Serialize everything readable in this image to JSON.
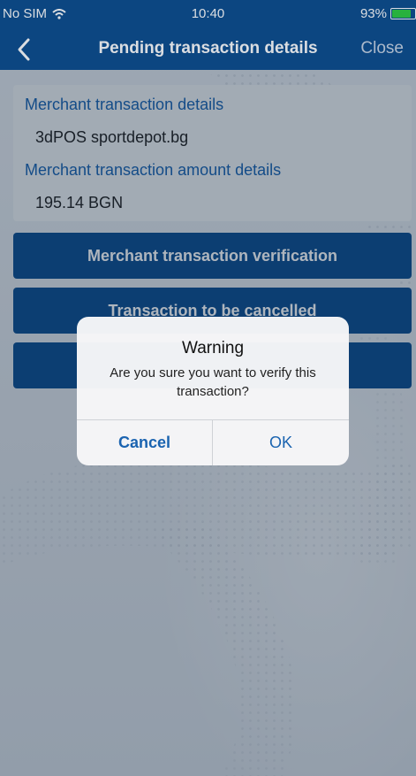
{
  "status": {
    "carrier": "No SIM",
    "time": "10:40",
    "battery": "93%",
    "battery_level": 0.93,
    "battery_color": "#2ecc40"
  },
  "nav": {
    "title": "Pending transaction details",
    "close_label": "Close",
    "back_icon": "chevron-left-icon"
  },
  "details": {
    "merchant_label": "Merchant transaction details",
    "merchant_value": "3dPOS sportdepot.bg",
    "amount_label": "Merchant transaction amount details",
    "amount_value": "195.14 BGN"
  },
  "actions": [
    {
      "label": "Merchant transaction verification"
    },
    {
      "label": "Transaction to be cancelled"
    },
    {
      "label": ""
    }
  ],
  "alert": {
    "title": "Warning",
    "message": "Are you sure you want to verify this transaction?",
    "cancel_label": "Cancel",
    "ok_label": "OK"
  },
  "colors": {
    "primary": "#0e4e8f",
    "link": "#1a63b0",
    "background": "#dfe4ea"
  }
}
